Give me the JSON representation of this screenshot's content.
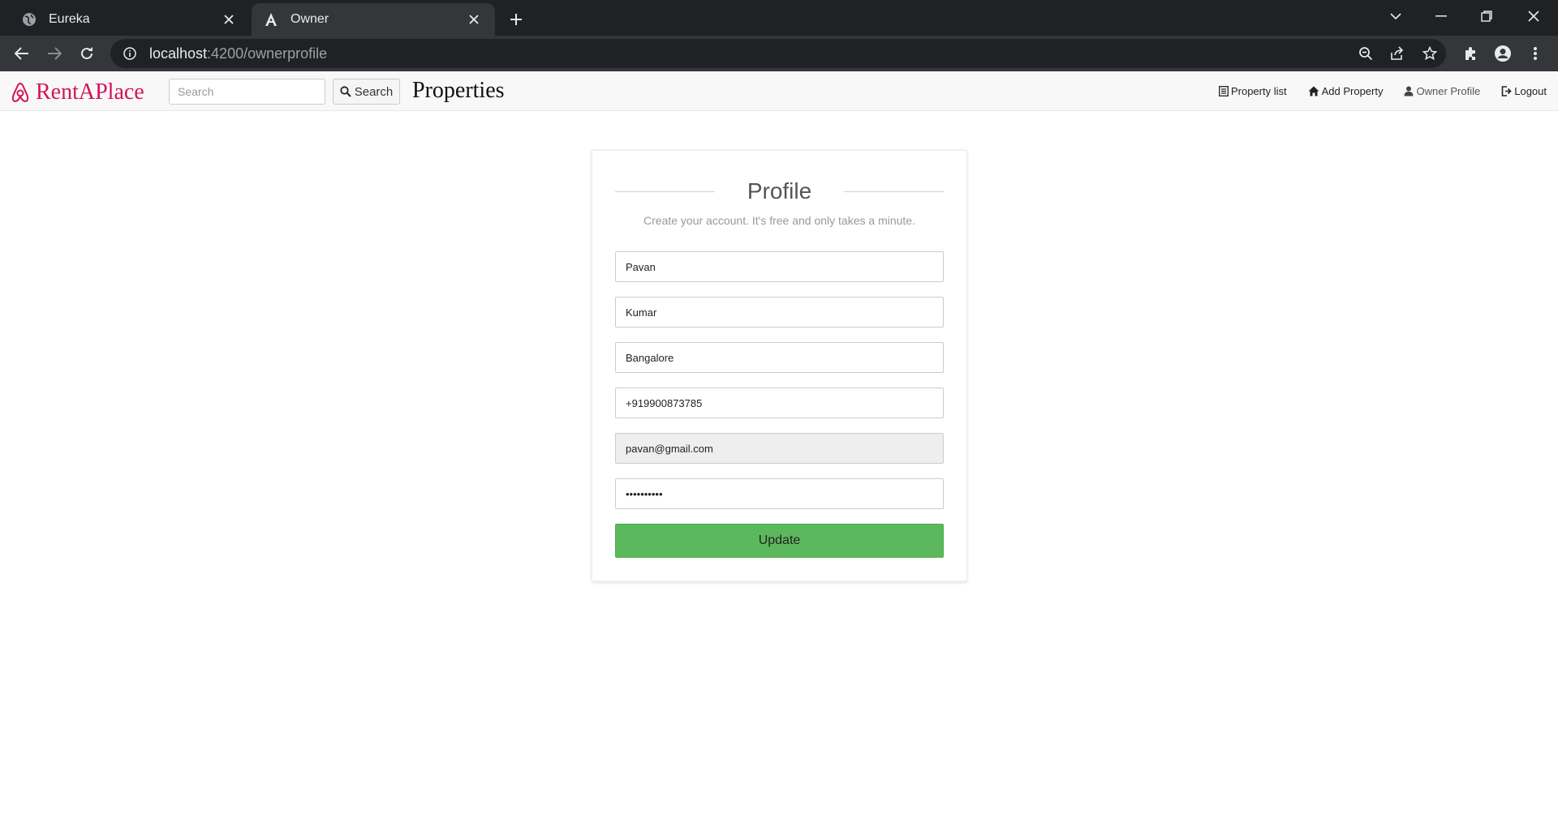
{
  "browser": {
    "tabs": [
      {
        "title": "Eureka",
        "active": false
      },
      {
        "title": "Owner",
        "active": true
      }
    ],
    "url_host": "localhost",
    "url_path": ":4200/ownerprofile"
  },
  "navbar": {
    "brand": "RentAPlace",
    "search_placeholder": "Search",
    "search_button": "Search",
    "section_title": "Properties",
    "links": [
      {
        "label": "Property list",
        "icon": "list-icon"
      },
      {
        "label": "Add Property",
        "icon": "home-icon"
      },
      {
        "label": "Owner Profile",
        "icon": "user-icon"
      },
      {
        "label": "Logout",
        "icon": "logout-icon"
      }
    ]
  },
  "form": {
    "title": "Profile",
    "hint": "Create your account. It's free and only takes a minute.",
    "first_name": "Pavan",
    "last_name": "Kumar",
    "city": "Bangalore",
    "phone": "+919900873785",
    "email": "pavan@gmail.com",
    "password": "••••••••••",
    "update_button": "Update"
  },
  "colors": {
    "brand": "#d4145a",
    "update_button": "#5cb85c"
  }
}
